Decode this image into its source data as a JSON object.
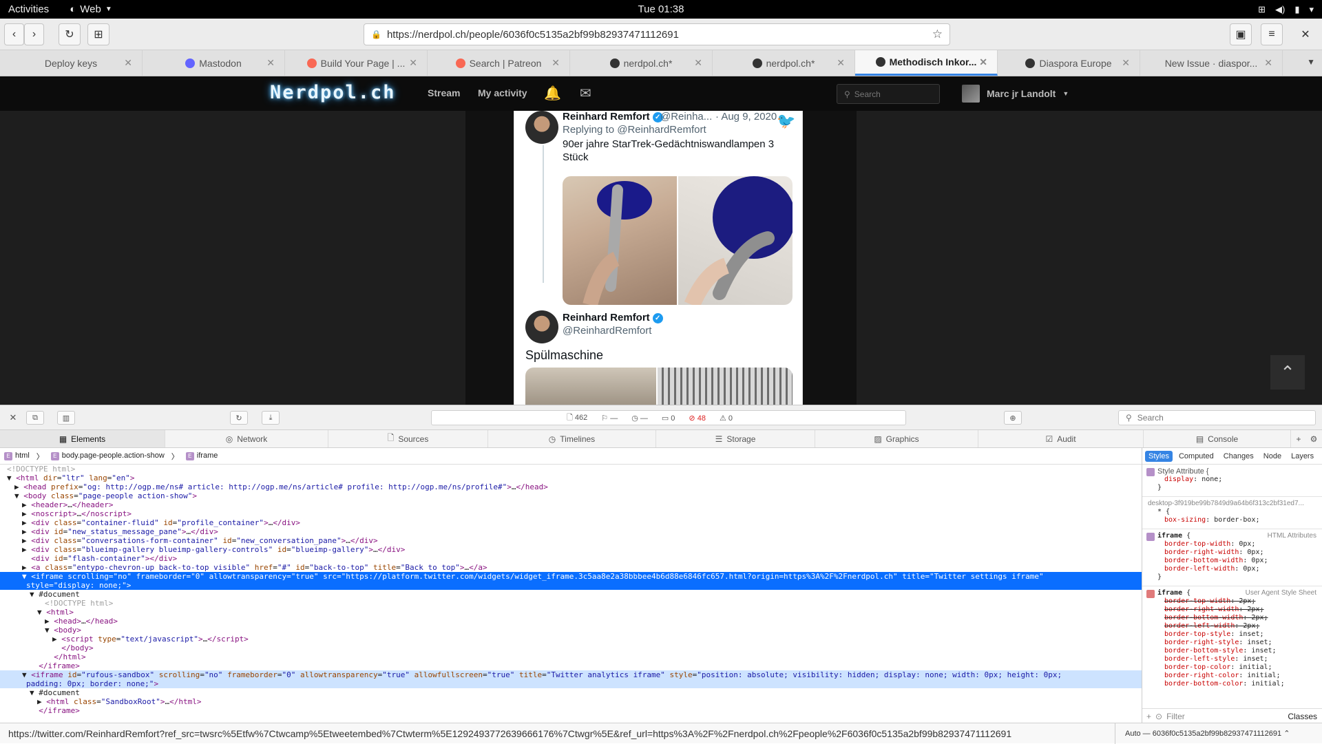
{
  "system": {
    "activities": "Activities",
    "app_name": "Web",
    "clock": "Tue 01:38"
  },
  "browser": {
    "url": "https://nerdpol.ch/people/6036f0c5135a2bf99b82937471112691",
    "tabs": [
      {
        "label": "Deploy keys",
        "icon_color": "",
        "active": false
      },
      {
        "label": "Mastodon",
        "icon_color": "#6364ff",
        "active": false
      },
      {
        "label": "Build Your Page | ...",
        "icon_color": "#f96854",
        "active": false
      },
      {
        "label": "Search | Patreon",
        "icon_color": "#f96854",
        "active": false
      },
      {
        "label": "nerdpol.ch*",
        "icon_color": "#333333",
        "active": false
      },
      {
        "label": "nerdpol.ch*",
        "icon_color": "#333333",
        "active": false
      },
      {
        "label": "Methodisch Inkor...",
        "icon_color": "#333333",
        "active": true
      },
      {
        "label": "Diaspora Europe",
        "icon_color": "#333333",
        "active": false
      },
      {
        "label": "New Issue · diaspor...",
        "icon_color": "",
        "active": false
      }
    ]
  },
  "site": {
    "logo": "Nerdpol.ch",
    "nav": {
      "stream": "Stream",
      "my_activity": "My activity"
    },
    "search_placeholder": "Search",
    "user_name": "Marc jr Landolt"
  },
  "tweet": {
    "author_name": "Reinhard Remfort",
    "author_handle_short": "@Reinha...",
    "date": "· Aug 9, 2020",
    "replying_to": "Replying to @ReinhardRemfort",
    "text1": "90er jahre StarTrek-Gedächtniswandlampen 3 Stück",
    "author_handle": "@ReinhardRemfort",
    "text2": "Spülmaschine"
  },
  "devtools": {
    "resource_count": "462",
    "dash_dash1": "—",
    "dash_dash2": "—",
    "log_count": "0",
    "error_count": "48",
    "warning_count": "0",
    "search_placeholder": "Search",
    "tabs": [
      "Elements",
      "Network",
      "Sources",
      "Timelines",
      "Storage",
      "Graphics",
      "Audit",
      "Console"
    ],
    "crumbs": [
      "html",
      "body.page-people.action-show",
      "iframe"
    ],
    "sidebar_tabs": [
      "Styles",
      "Computed",
      "Changes",
      "Node",
      "Layers"
    ],
    "filter_placeholder": "Filter",
    "classes": "Classes",
    "style_attr_label": "Style Attribute",
    "stylesheet_src": "desktop-3f919be99b7849d9a64b6f313c2bf31ed7...",
    "html_attributes": "HTML Attributes",
    "ua_stylesheet": "User Agent Style Sheet",
    "auto_label": "Auto — 6036f0c5135a2bf99b82937471112691 ⌃"
  },
  "status_url": "https://twitter.com/ReinhardRemfort?ref_src=twsrc%5Etfw%7Ctwcamp%5Etweetembed%7Ctwterm%5E1292493772639666176%7Ctwgr%5E&ref_url=https%3A%2F%2Fnerdpol.ch%2Fpeople%2F6036f0c5135a2bf99b82937471112691"
}
